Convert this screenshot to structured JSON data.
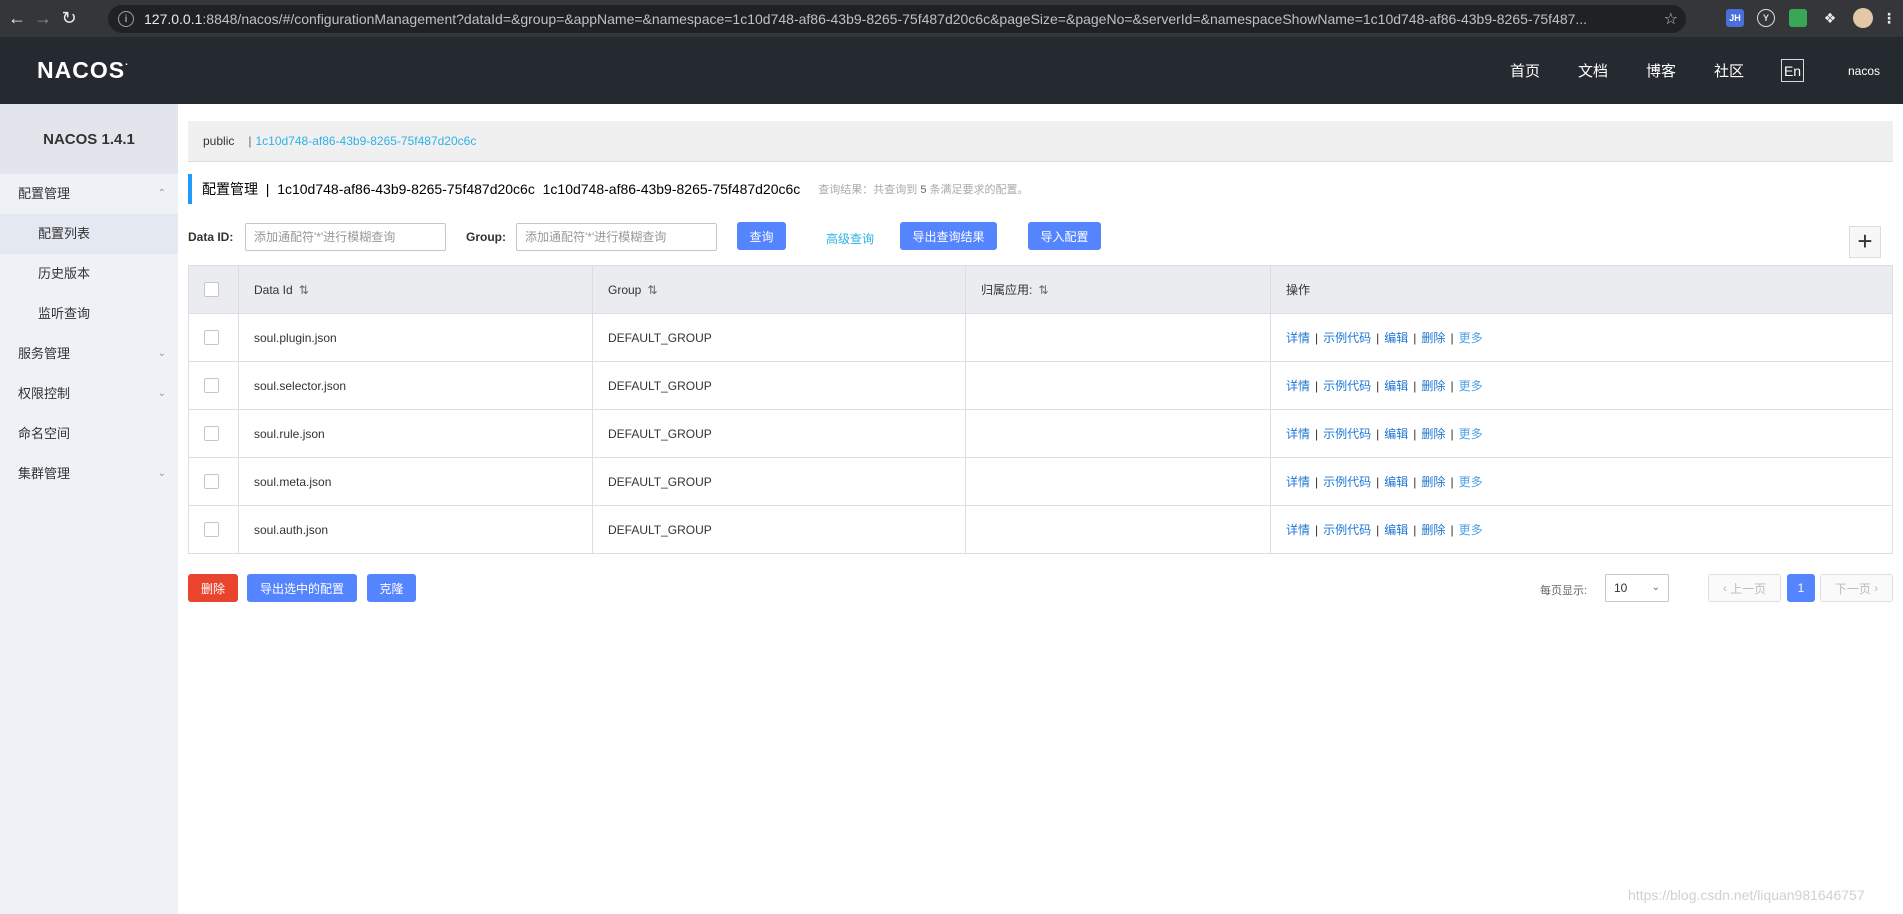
{
  "browser": {
    "url_host": "127.0.0.1",
    "url_rest": ":8848/nacos/#/configurationManagement?dataId=&group=&appName=&namespace=1c10d748-af86-43b9-8265-75f487d20c6c&pageSize=&pageNo=&serverId=&namespaceShowName=1c10d748-af86-43b9-8265-75f487...",
    "ext_jh": "JH"
  },
  "header": {
    "logo": "NACOS",
    "nav": [
      "首页",
      "文档",
      "博客",
      "社区"
    ],
    "lang": "En",
    "user": "nacos"
  },
  "sidebar": {
    "version": "NACOS 1.4.1",
    "items": [
      {
        "label": "配置管理",
        "type": "group",
        "open": true
      },
      {
        "label": "配置列表",
        "type": "sub",
        "active": true
      },
      {
        "label": "历史版本",
        "type": "sub"
      },
      {
        "label": "监听查询",
        "type": "sub"
      },
      {
        "label": "服务管理",
        "type": "group"
      },
      {
        "label": "权限控制",
        "type": "group"
      },
      {
        "label": "命名空间",
        "type": "plain"
      },
      {
        "label": "集群管理",
        "type": "group"
      }
    ]
  },
  "namespace_bar": {
    "items": [
      "public",
      "1c10d748-af86-43b9-8265-75f487d20c6c"
    ],
    "separator": "|"
  },
  "title": {
    "text": "配置管理  |  1c10d748-af86-43b9-8265-75f487d20c6c  1c10d748-af86-43b9-8265-75f487d20c6c",
    "hint_prefix": "查询结果：共查询到",
    "hint_count": "5",
    "hint_suffix": "条满足要求的配置。"
  },
  "search": {
    "dataid_label": "Data ID:",
    "dataid_placeholder": "添加通配符'*'进行模糊查询",
    "group_label": "Group:",
    "group_placeholder": "添加通配符'*'进行模糊查询",
    "query_btn": "查询",
    "advanced_link": "高级查询",
    "export_btn": "导出查询结果",
    "import_btn": "导入配置",
    "add_btn": "+"
  },
  "table": {
    "headers": [
      "Data Id",
      "Group",
      "归属应用:",
      "操作"
    ],
    "rows": [
      {
        "dataId": "soul.plugin.json",
        "group": "DEFAULT_GROUP",
        "app": ""
      },
      {
        "dataId": "soul.selector.json",
        "group": "DEFAULT_GROUP",
        "app": ""
      },
      {
        "dataId": "soul.rule.json",
        "group": "DEFAULT_GROUP",
        "app": ""
      },
      {
        "dataId": "soul.meta.json",
        "group": "DEFAULT_GROUP",
        "app": ""
      },
      {
        "dataId": "soul.auth.json",
        "group": "DEFAULT_GROUP",
        "app": ""
      }
    ],
    "ops": [
      "详情",
      "示例代码",
      "编辑",
      "删除",
      "更多"
    ]
  },
  "bottom": {
    "delete_btn": "删除",
    "export_selected_btn": "导出选中的配置",
    "clone_btn": "克隆",
    "page_size_label": "每页显示:",
    "page_size": "10",
    "prev": "上一页",
    "current_page": "1",
    "next": "下一页"
  },
  "watermark": "https://blog.csdn.net/liquan981646757",
  "colors": {
    "primary": "#5584ff",
    "danger": "#e8442e",
    "header_bg": "#252a31",
    "link": "#2eb2e6"
  }
}
